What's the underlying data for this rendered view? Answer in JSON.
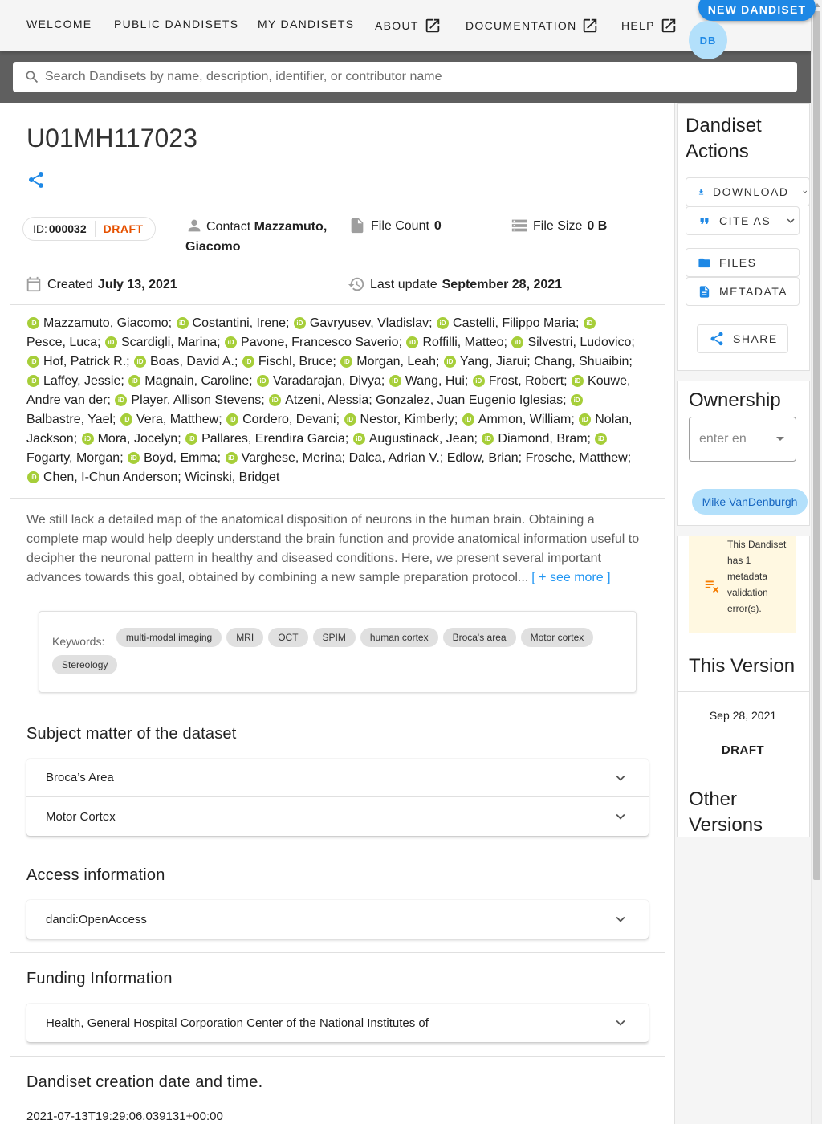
{
  "nav": {
    "items": [
      {
        "label": "WELCOME",
        "external": false
      },
      {
        "label": "PUBLIC DANDISETS",
        "external": false
      },
      {
        "label": "MY DANDISETS",
        "external": false
      },
      {
        "label": "ABOUT",
        "external": true
      },
      {
        "label": "DOCUMENTATION",
        "external": true
      },
      {
        "label": "HELP",
        "external": true
      }
    ],
    "new_dandiset_label": "NEW DANDISET",
    "avatar_initials": "DB"
  },
  "search": {
    "placeholder": "Search Dandisets by name, description, identifier, or contributor name"
  },
  "dandiset": {
    "title": "U01MH117023",
    "id_label": "ID:",
    "id": "000032",
    "status": "DRAFT",
    "contact_label": "Contact",
    "contact_name_line1": "Mazzamuto,",
    "contact_name_line2": "Giacomo",
    "file_count_label": "File Count",
    "file_count": "0",
    "file_size_label": "File Size",
    "file_size": "0 B",
    "created_label": "Created",
    "created": "July 13, 2021",
    "updated_label": "Last update",
    "updated": "September 28, 2021"
  },
  "contributors": [
    {
      "name": "Mazzamuto, Giacomo",
      "orcid": true
    },
    {
      "name": "Costantini, Irene",
      "orcid": true
    },
    {
      "name": "Gavryusev, Vladislav",
      "orcid": true
    },
    {
      "name": "Castelli, Filippo Maria",
      "orcid": true
    },
    {
      "name": "Pesce, Luca",
      "orcid": true
    },
    {
      "name": "Scardigli, Marina",
      "orcid": true
    },
    {
      "name": "Pavone, Francesco Saverio",
      "orcid": true
    },
    {
      "name": "Roffilli, Matteo",
      "orcid": true
    },
    {
      "name": "Silvestri, Ludovico",
      "orcid": true
    },
    {
      "name": "Hof, Patrick R.",
      "orcid": true
    },
    {
      "name": "Boas, David A.",
      "orcid": true
    },
    {
      "name": "Fischl, Bruce",
      "orcid": true
    },
    {
      "name": "Morgan, Leah",
      "orcid": true
    },
    {
      "name": "Yang, Jiarui",
      "orcid": true
    },
    {
      "name": "Chang, Shuaibin",
      "orcid": false
    },
    {
      "name": "Laffey, Jessie",
      "orcid": true
    },
    {
      "name": "Magnain, Caroline",
      "orcid": true
    },
    {
      "name": "Varadarajan, Divya",
      "orcid": true
    },
    {
      "name": "Wang, Hui",
      "orcid": true
    },
    {
      "name": "Frost, Robert",
      "orcid": true
    },
    {
      "name": "Kouwe, Andre van der",
      "orcid": true
    },
    {
      "name": "Player, Allison Stevens",
      "orcid": true
    },
    {
      "name": "Atzeni, Alessia",
      "orcid": true
    },
    {
      "name": "Gonzalez, Juan Eugenio Iglesias",
      "orcid": false
    },
    {
      "name": "Balbastre, Yael",
      "orcid": true
    },
    {
      "name": "Vera, Matthew",
      "orcid": true
    },
    {
      "name": "Cordero, Devani",
      "orcid": true
    },
    {
      "name": "Nestor, Kimberly",
      "orcid": true
    },
    {
      "name": "Ammon, William",
      "orcid": true
    },
    {
      "name": "Nolan, Jackson",
      "orcid": true
    },
    {
      "name": "Mora, Jocelyn",
      "orcid": true
    },
    {
      "name": "Pallares, Erendira Garcia",
      "orcid": true
    },
    {
      "name": "Augustinack, Jean",
      "orcid": true
    },
    {
      "name": "Diamond, Bram",
      "orcid": true
    },
    {
      "name": "Fogarty, Morgan",
      "orcid": true
    },
    {
      "name": "Boyd, Emma",
      "orcid": true
    },
    {
      "name": "Varghese, Merina",
      "orcid": true
    },
    {
      "name": "Dalca, Adrian V.",
      "orcid": false
    },
    {
      "name": "Edlow, Brian",
      "orcid": false
    },
    {
      "name": "Frosche, Matthew",
      "orcid": false
    },
    {
      "name": "Chen, I-Chun Anderson",
      "orcid": true
    },
    {
      "name": "Wicinski, Bridget",
      "orcid": false
    }
  ],
  "description": {
    "text": "We still lack a detailed map of the anatomical disposition of neurons in the human brain. Obtaining a complete map would help deeply understand the brain function and provide anatomical information useful to decipher the neuronal pattern in healthy and diseased conditions. Here, we present several important advances towards this goal, obtained by combining a new sample preparation protocol...",
    "see_more": "[ + see more ]"
  },
  "keywords": {
    "label": "Keywords:",
    "items": [
      "multi-modal imaging",
      "MRI",
      "OCT",
      "SPIM",
      "human cortex",
      "Broca's area",
      "Motor cortex",
      "Stereology"
    ]
  },
  "sections": {
    "subject": {
      "title": "Subject matter of the dataset",
      "rows": [
        "Broca’s Area",
        "Motor Cortex"
      ]
    },
    "access": {
      "title": "Access information",
      "rows": [
        "dandi:OpenAccess"
      ]
    },
    "funding": {
      "title": "Funding Information",
      "rows": [
        "Health, General Hospital Corporation Center of the National Institutes of"
      ]
    },
    "creation": {
      "title": "Dandiset creation date and time.",
      "value": "2021-07-13T19:29:06.039131+00:00"
    }
  },
  "sidebar": {
    "actions_title_line1": "Dandiset",
    "actions_title_line2": "Actions",
    "download_label": "DOWNLOAD",
    "cite_label": "CITE AS",
    "files_label": "FILES",
    "metadata_label": "METADATA",
    "share_label": "SHARE",
    "ownership_title": "Ownership",
    "owner_input_placeholder": "enter en",
    "owner_chip": "Mike VanDenburgh",
    "validation_text": "This Dandiset has 1 metadata validation error(s).",
    "this_version_title": "This Version",
    "version_date": "Sep 28, 2021",
    "version_status": "DRAFT",
    "other_versions_line1": "Other",
    "other_versions_line2": "Versions"
  },
  "colors": {
    "accent": "#1e88e5",
    "draft": "#e65100",
    "orcid": "#a6ce39",
    "warning_bg": "#fff8e1",
    "warning_icon": "#f57c00"
  }
}
